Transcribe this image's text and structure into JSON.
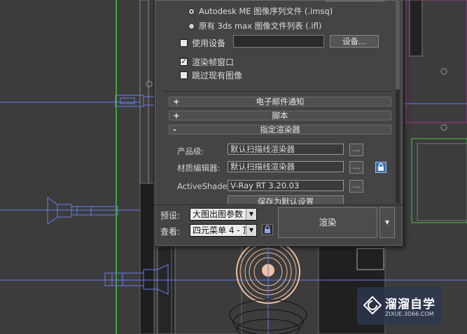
{
  "dialog": {
    "output_options": {
      "radio_imsq_label": "Autodesk ME 图像序列文件 (.imsq)",
      "radio_ifl_label": "原有 3ds max 图像文件列表 (.ifl)",
      "use_device_label": "使用设备",
      "device_button_label": "设备...",
      "render_frame_window_label": "渲染帧窗口",
      "skip_existing_label": "跳过现有图像"
    },
    "rollouts": {
      "email": {
        "sign": "+",
        "title": "电子邮件通知"
      },
      "scripts": {
        "sign": "+",
        "title": "脚本"
      },
      "assign_renderer": {
        "sign": "-",
        "title": "指定渲染器"
      }
    },
    "assign_renderer": {
      "production_label": "产品级:",
      "production_value": "默认扫描线渲染器",
      "material_editor_label": "材质编辑器:",
      "material_editor_value": "默认扫描线渲染器",
      "activeshade_label": "ActiveShade:",
      "activeshade_value": "V-Ray RT 3.20.03",
      "browse_label": "...",
      "save_default_label": "保存为默认设置"
    },
    "bottom": {
      "preset_label": "预设:",
      "preset_value": "大图出图参数",
      "view_label": "查看:",
      "view_value": "四元菜单 4 - 顶",
      "render_label": "渲染",
      "dropdown_arrow": "▼"
    }
  },
  "watermark": {
    "title": "溜溜自学",
    "subtitle": "ZIXUE.3D66.COM"
  },
  "colors": {
    "viewport_bg": "#3c3c3c",
    "gizmo_blue": "#6a7cf0",
    "object_orange": "#f0c0a0",
    "object_green": "#4ec04e",
    "lock_blue": "#3c6da6"
  },
  "icons": {
    "lock": "lock-icon",
    "chevron": "chevron-down-icon"
  }
}
